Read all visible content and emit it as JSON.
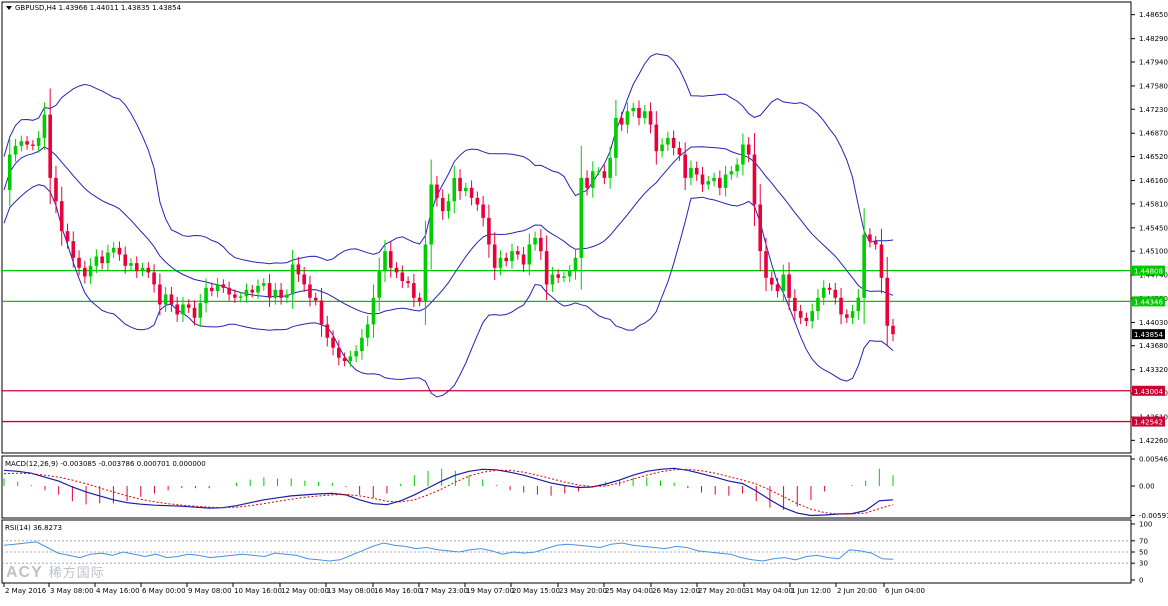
{
  "header": {
    "text": "GBPUSD,H4  1.43966 1.44011 1.43835 1.43854"
  },
  "colors": {
    "bull": "#00cc00",
    "bear": "#e8003a",
    "band": "#2323b8",
    "hline_green": "#00c800",
    "hline_red": "#cc0033",
    "macd_line": "#1a1aa8",
    "macd_signal": "#e00000",
    "rsi": "#4a90e2",
    "price_tag_black": "#000000"
  },
  "watermark": {
    "brand": "ACY",
    "sub": "稀方国际"
  },
  "chart_data": [
    {
      "type": "candlestick",
      "title": "GBPUSD,H4",
      "ohlc_last": {
        "open": 1.43966,
        "high": 1.44011,
        "low": 1.43835,
        "close": 1.43854
      },
      "y_ticks": [
        1.4865,
        1.4829,
        1.4794,
        1.4758,
        1.4723,
        1.4687,
        1.4652,
        1.4616,
        1.4581,
        1.4545,
        1.451,
        1.4474,
        1.4439,
        1.4403,
        1.4368,
        1.4332,
        1.4297,
        1.4261,
        1.4226
      ],
      "y_tick_labels": [
        "1.48650",
        "1.48290",
        "1.47940",
        "1.47580",
        "1.47230",
        "1.46870",
        "1.46520",
        "1.46160",
        "1.45810",
        "1.45450",
        "1.45100",
        "1.44740",
        "1.44390",
        "1.44030",
        "1.43680",
        "1.43320",
        "1.42970",
        "1.42610",
        "1.42260"
      ],
      "ylim": [
        1.4207,
        1.4884
      ],
      "x_tick_labels": [
        "2 May 2016",
        "3 May 08:00",
        "4 May 16:00",
        "6 May 00:00",
        "9 May 08:00",
        "10 May 16:00",
        "12 May 00:00",
        "13 May 08:00",
        "16 May 16:00",
        "17 May 23:00",
        "19 May 07:00",
        "20 May 15:00",
        "23 May 20:00",
        "25 May 04:00",
        "26 May 12:00",
        "27 May 20:00",
        "31 May 04:00",
        "1 Jun 12:00",
        "2 Jun 20:00",
        "6 Jun 04:00"
      ],
      "horizontal_lines": [
        {
          "value": 1.44808,
          "label": "1.44808",
          "color": "green"
        },
        {
          "value": 1.44346,
          "label": "1.44346",
          "color": "green"
        },
        {
          "value": 1.43004,
          "label": "1.43004",
          "color": "red"
        },
        {
          "value": 1.42542,
          "label": "1.42542",
          "color": "red"
        }
      ],
      "current_price_label": "1.43854",
      "overlay": "Bollinger Bands",
      "closes": [
        1.4602,
        1.4655,
        1.4668,
        1.4675,
        1.467,
        1.4668,
        1.468,
        1.4715,
        1.462,
        1.4585,
        1.454,
        1.4525,
        1.45,
        1.4485,
        1.4472,
        1.4488,
        1.4502,
        1.4492,
        1.4508,
        1.4515,
        1.4505,
        1.4488,
        1.4492,
        1.448,
        1.4485,
        1.4478,
        1.446,
        1.443,
        1.4445,
        1.443,
        1.4415,
        1.443,
        1.4425,
        1.441,
        1.4432,
        1.4455,
        1.445,
        1.446,
        1.4455,
        1.4445,
        1.444,
        1.4442,
        1.4452,
        1.4448,
        1.4458,
        1.4462,
        1.444,
        1.4452,
        1.444,
        1.4445,
        1.449,
        1.4475,
        1.446,
        1.444,
        1.4436,
        1.44,
        1.438,
        1.4365,
        1.435,
        1.4345,
        1.4352,
        1.436,
        1.438,
        1.44,
        1.444,
        1.448,
        1.451,
        1.4485,
        1.4478,
        1.4465,
        1.4462,
        1.444,
        1.4435,
        1.452,
        1.461,
        1.459,
        1.457,
        1.4585,
        1.462,
        1.46,
        1.4605,
        1.459,
        1.458,
        1.456,
        1.452,
        1.4485,
        1.45,
        1.4495,
        1.451,
        1.4505,
        1.449,
        1.452,
        1.453,
        1.451,
        1.446,
        1.4475,
        1.447,
        1.4472,
        1.448,
        1.45,
        1.462,
        1.4605,
        1.463,
        1.463,
        1.462,
        1.465,
        1.471,
        1.47,
        1.472,
        1.4725,
        1.471,
        1.472,
        1.47,
        1.466,
        1.467,
        1.468,
        1.4665,
        1.4655,
        1.462,
        1.4635,
        1.4625,
        1.461,
        1.4615,
        1.462,
        1.4605,
        1.4625,
        1.463,
        1.464,
        1.467,
        1.4655,
        1.458,
        1.451,
        1.447,
        1.446,
        1.445,
        1.4475,
        1.444,
        1.442,
        1.441,
        1.4405,
        1.442,
        1.444,
        1.4455,
        1.4452,
        1.444,
        1.4415,
        1.441,
        1.442,
        1.444,
        1.4535,
        1.4525,
        1.452,
        1.447,
        1.4398,
        1.43854
      ]
    },
    {
      "type": "line",
      "title": "MACD(12,26,9) -0.003085 -0.003786 0.000701 0.000000",
      "y_tick_labels": [
        "0.005463",
        "0.00",
        "-0.005971"
      ],
      "ylim": [
        -0.0063,
        0.0059
      ],
      "series": [
        {
          "name": "MACD",
          "values": [
            0.0032,
            0.003,
            0.0026,
            0.0018,
            0.001,
            -0.0002,
            -0.0012,
            -0.002,
            -0.0028,
            -0.0034,
            -0.0037,
            -0.0039,
            -0.004,
            -0.0041,
            -0.0043,
            -0.0045,
            -0.0044,
            -0.004,
            -0.0034,
            -0.0028,
            -0.0024,
            -0.002,
            -0.0018,
            -0.0016,
            -0.0015,
            -0.0018,
            -0.0028,
            -0.0036,
            -0.0038,
            -0.003,
            -0.0018,
            -0.0004,
            0.001,
            0.0022,
            0.003,
            0.0034,
            0.0033,
            0.0028,
            0.0022,
            0.0014,
            0.0006,
            0.0001,
            -0.0003,
            -0.0002,
            0.0004,
            0.0012,
            0.0022,
            0.003,
            0.0034,
            0.0036,
            0.0032,
            0.0025,
            0.0018,
            0.001,
            0.0005,
            -0.001,
            -0.0028,
            -0.0044,
            -0.0055,
            -0.006,
            -0.0059,
            -0.0057,
            -0.0056,
            -0.005,
            -0.003,
            -0.0028
          ]
        },
        {
          "name": "Signal",
          "values": [
            0.0025,
            0.0026,
            0.0025,
            0.0022,
            0.0018,
            0.0012,
            0.0005,
            -0.0004,
            -0.0012,
            -0.002,
            -0.0027,
            -0.0032,
            -0.0036,
            -0.0039,
            -0.0041,
            -0.0043,
            -0.0044,
            -0.0043,
            -0.004,
            -0.0036,
            -0.0031,
            -0.0027,
            -0.0023,
            -0.002,
            -0.0018,
            -0.0017,
            -0.002,
            -0.0025,
            -0.0031,
            -0.0032,
            -0.0028,
            -0.0018,
            -0.0006,
            0.0008,
            0.002,
            0.0028,
            0.0032,
            0.0032,
            0.0028,
            0.0022,
            0.0015,
            0.0008,
            0.0002,
            -0.0001,
            0.0,
            0.0006,
            0.0014,
            0.0022,
            0.0029,
            0.0033,
            0.0034,
            0.0031,
            0.0026,
            0.0019,
            0.0012,
            0.0004,
            -0.0008,
            -0.0022,
            -0.0036,
            -0.0047,
            -0.0054,
            -0.0057,
            -0.0057,
            -0.0055,
            -0.0046,
            -0.0038
          ]
        }
      ]
    },
    {
      "type": "line",
      "title": "RSI(14) 36.8273",
      "y_tick_labels": [
        "100",
        "70",
        "50",
        "30",
        "0"
      ],
      "levels": [
        70,
        50,
        30
      ],
      "ylim": [
        0,
        100
      ],
      "series": [
        {
          "name": "RSI",
          "values": [
            62,
            64,
            66,
            68,
            58,
            48,
            44,
            40,
            46,
            48,
            44,
            50,
            46,
            42,
            46,
            40,
            42,
            46,
            44,
            40,
            42,
            44,
            46,
            44,
            42,
            48,
            46,
            44,
            38,
            36,
            34,
            36,
            44,
            52,
            60,
            66,
            62,
            60,
            56,
            58,
            54,
            52,
            50,
            54,
            56,
            52,
            46,
            50,
            48,
            50,
            56,
            62,
            64,
            62,
            60,
            58,
            64,
            66,
            62,
            60,
            58,
            56,
            60,
            58,
            52,
            50,
            48,
            46,
            40,
            36,
            34,
            38,
            40,
            36,
            42,
            44,
            40,
            38,
            54,
            52,
            48,
            38,
            37
          ]
        }
      ]
    }
  ]
}
